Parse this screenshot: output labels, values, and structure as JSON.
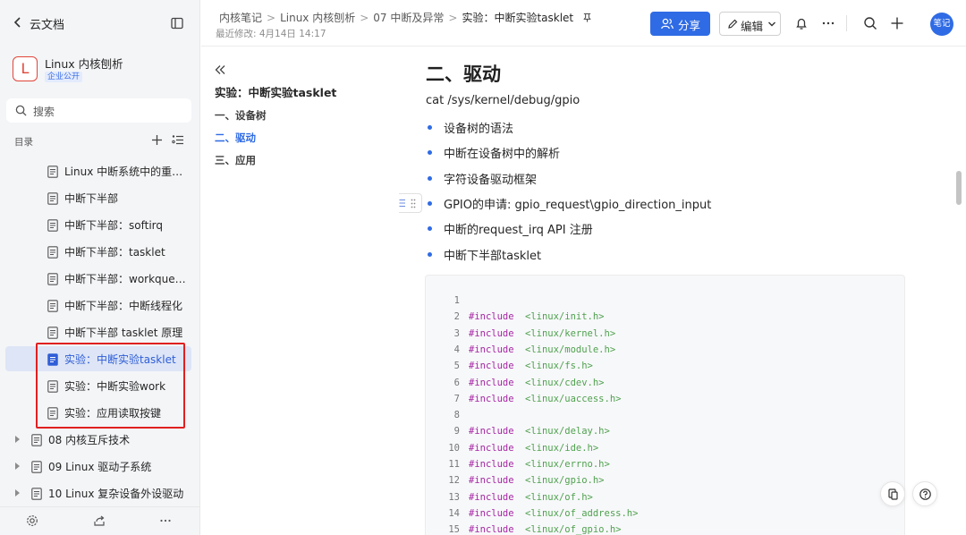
{
  "sidebar": {
    "back_label": "云文档",
    "space": {
      "logo_letter": "L",
      "name": "Linux 内核刨析",
      "tag": "企业公开"
    },
    "search_placeholder": "搜索",
    "toc_label": "目录",
    "items": [
      {
        "label": "Linux 中断系统中的重要...",
        "level": 2,
        "active": false
      },
      {
        "label": "中断下半部",
        "level": 2,
        "active": false
      },
      {
        "label": "中断下半部：softirq",
        "level": 2,
        "active": false
      },
      {
        "label": "中断下半部：tasklet",
        "level": 2,
        "active": false
      },
      {
        "label": "中断下半部：workqueue",
        "level": 2,
        "active": false
      },
      {
        "label": "中断下半部：中断线程化",
        "level": 2,
        "active": false
      },
      {
        "label": "中断下半部 tasklet 原理",
        "level": 2,
        "active": false
      },
      {
        "label": "实验：中断实验tasklet",
        "level": 2,
        "active": true
      },
      {
        "label": "实验：中断实验work",
        "level": 2,
        "active": false
      },
      {
        "label": "实验：应用读取按键",
        "level": 2,
        "active": false
      },
      {
        "label": "08 内核互斥技术",
        "level": 1,
        "active": false
      },
      {
        "label": "09 Linux 驱动子系统",
        "level": 1,
        "active": false
      },
      {
        "label": "10 Linux 复杂设备外设驱动",
        "level": 1,
        "active": false
      }
    ]
  },
  "header": {
    "breadcrumbs": [
      "内核笔记",
      "Linux 内核刨析",
      "07 中断及异常",
      "实验：中断实验tasklet"
    ],
    "modified": "最近修改: 4月14日 14:17",
    "share_label": "分享",
    "edit_label": "编辑",
    "avatar_label": "笔记"
  },
  "outline": {
    "title": "实验：中断实验tasklet",
    "items": [
      {
        "label": "一、设备树",
        "active": false
      },
      {
        "label": "二、驱动",
        "active": true
      },
      {
        "label": "三、应用",
        "active": false
      }
    ]
  },
  "content": {
    "heading": "二、驱动",
    "path_line": "cat /sys/kernel/debug/gpio",
    "bullets": [
      "设备树的语法",
      "中断在设备树中的解析",
      "字符设备驱动框架",
      "GPIO的申请: gpio_request\\gpio_direction_input",
      "中断的request_irq API 注册",
      "中断下半部tasklet"
    ],
    "code_lines": [
      {
        "n": "1",
        "kw": "",
        "inc": ""
      },
      {
        "n": "2",
        "kw": "#include",
        "inc": "<linux/init.h>"
      },
      {
        "n": "3",
        "kw": "#include",
        "inc": "<linux/kernel.h>"
      },
      {
        "n": "4",
        "kw": "#include",
        "inc": "<linux/module.h>"
      },
      {
        "n": "5",
        "kw": "#include",
        "inc": "<linux/fs.h>"
      },
      {
        "n": "6",
        "kw": "#include",
        "inc": "<linux/cdev.h>"
      },
      {
        "n": "7",
        "kw": "#include",
        "inc": "<linux/uaccess.h>"
      },
      {
        "n": "8",
        "kw": "",
        "inc": ""
      },
      {
        "n": "9",
        "kw": "#include",
        "inc": "<linux/delay.h>"
      },
      {
        "n": "10",
        "kw": "#include",
        "inc": "<linux/ide.h>"
      },
      {
        "n": "11",
        "kw": "#include",
        "inc": "<linux/errno.h>"
      },
      {
        "n": "12",
        "kw": "#include",
        "inc": "<linux/gpio.h>"
      },
      {
        "n": "13",
        "kw": "#include",
        "inc": "<linux/of.h>"
      },
      {
        "n": "14",
        "kw": "#include",
        "inc": "<linux/of_address.h>"
      },
      {
        "n": "15",
        "kw": "#include",
        "inc": "<linux/of_gpio.h>"
      }
    ]
  },
  "colors": {
    "accent": "#2f6be4",
    "highlight_box": "#e02020",
    "code_keyword": "#a626a4",
    "code_include": "#50a14f"
  }
}
